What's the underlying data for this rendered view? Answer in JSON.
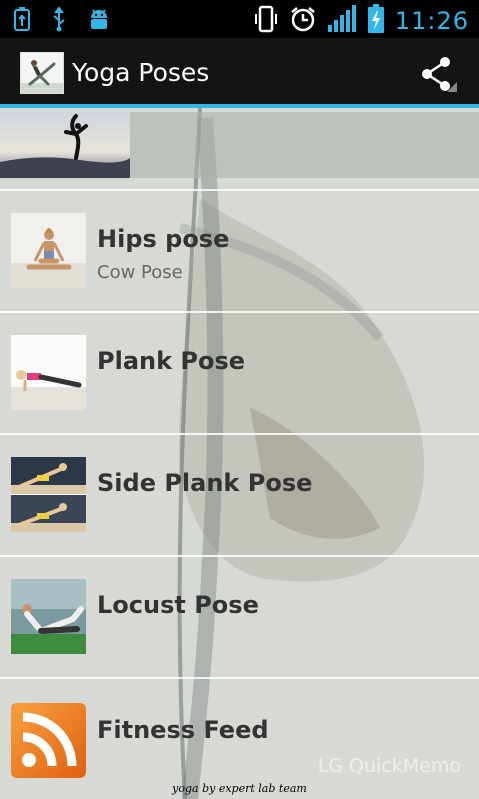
{
  "status_bar": {
    "time": "11:26",
    "icons": [
      "usb-debug-icon",
      "usb-icon",
      "android-icon",
      "vibrate-icon",
      "alarm-icon",
      "signal-icon",
      "battery-charging-icon"
    ]
  },
  "action_bar": {
    "title": "Yoga Poses",
    "share_icon": "share-icon",
    "accent_color": "#33b5e5"
  },
  "items": [
    {
      "title": "Hips pose",
      "subtitle": "Cow Pose"
    },
    {
      "title": "Plank Pose",
      "subtitle": ""
    },
    {
      "title": "Side Plank Pose",
      "subtitle": ""
    },
    {
      "title": "Locust Pose",
      "subtitle": ""
    },
    {
      "title": "Fitness Feed",
      "subtitle": ""
    }
  ],
  "watermark": "LG QuickMemo",
  "footer": "yoga by expert lab team"
}
